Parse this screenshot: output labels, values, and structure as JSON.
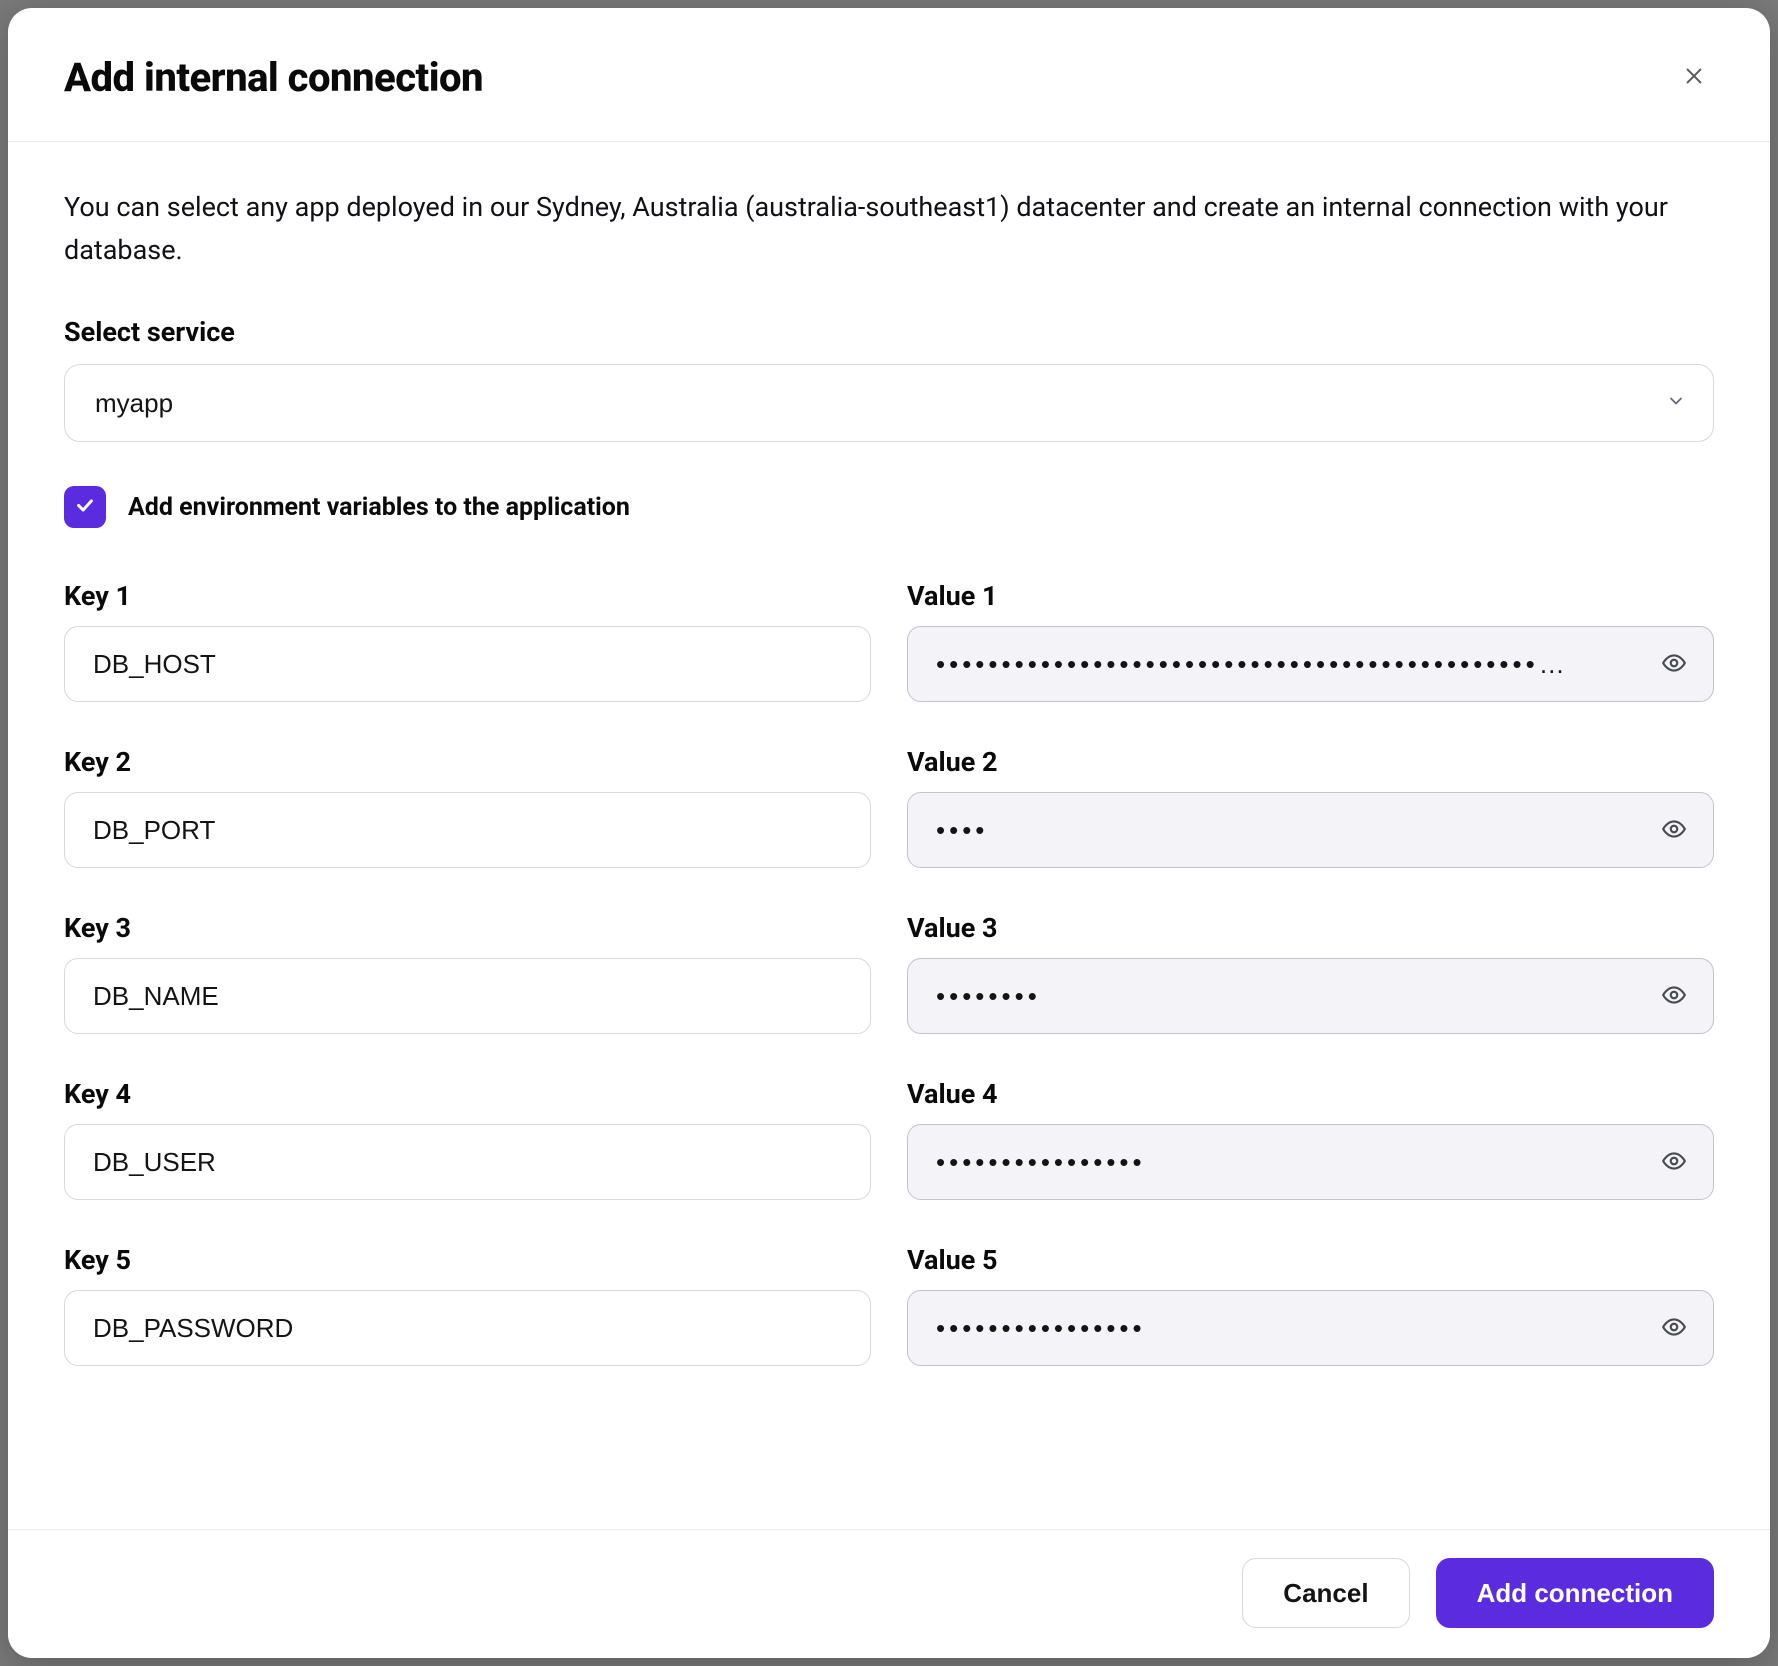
{
  "modal": {
    "title": "Add internal connection",
    "intro": "You can select any app deployed in our Sydney, Australia (australia-southeast1) datacenter and create an internal connection with your database.",
    "select_label": "Select service",
    "select_value": "myapp",
    "checkbox_label": "Add environment variables to the application",
    "checkbox_checked": true,
    "pairs": [
      {
        "key_label": "Key 1",
        "value_label": "Value 1",
        "key": "DB_HOST",
        "value": "••••••••••••••••••••••••••••••••••••••••••••••…"
      },
      {
        "key_label": "Key 2",
        "value_label": "Value 2",
        "key": "DB_PORT",
        "value": "••••"
      },
      {
        "key_label": "Key 3",
        "value_label": "Value 3",
        "key": "DB_NAME",
        "value": "••••••••"
      },
      {
        "key_label": "Key 4",
        "value_label": "Value 4",
        "key": "DB_USER",
        "value": "••••••••••••••••"
      },
      {
        "key_label": "Key 5",
        "value_label": "Value 5",
        "key": "DB_PASSWORD",
        "value": "••••••••••••••••"
      }
    ],
    "footer": {
      "cancel": "Cancel",
      "submit": "Add connection"
    }
  },
  "colors": {
    "accent": "#5b2be0",
    "input_bg_readonly": "#f4f4f8",
    "border": "#d8d8de"
  }
}
